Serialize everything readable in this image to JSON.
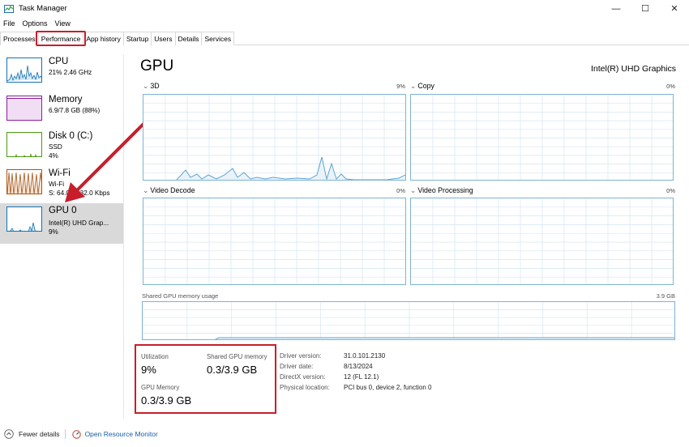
{
  "window": {
    "title": "Task Manager",
    "minimize": "—",
    "maximize": "☐",
    "close": "✕"
  },
  "menu": [
    "File",
    "Options",
    "View"
  ],
  "tabs": [
    "Processes",
    "Performance",
    "App history",
    "Startup",
    "Users",
    "Details",
    "Services"
  ],
  "sidebar": [
    {
      "name": "CPU",
      "line1": "21% 2.46 GHz",
      "line2": "",
      "color": "#1473b3"
    },
    {
      "name": "Memory",
      "line1": "6.9/7.8 GB (88%)",
      "line2": "",
      "color": "#8b1e9b"
    },
    {
      "name": "Disk 0 (C:)",
      "line1": "SSD",
      "line2": "4%",
      "color": "#4d9a11"
    },
    {
      "name": "Wi-Fi",
      "line1": "Wi-Fi",
      "line2": "S: 64.0  R: 32.0 Kbps",
      "color": "#a7561b"
    },
    {
      "name": "GPU 0",
      "line1": "Intel(R) UHD Grap...",
      "line2": "9%",
      "color": "#1473b3"
    }
  ],
  "main": {
    "title": "GPU",
    "device": "Intel(R) UHD Graphics",
    "graphs": [
      {
        "label": "3D",
        "pct": "9%"
      },
      {
        "label": "Copy",
        "pct": "0%"
      },
      {
        "label": "Video Decode",
        "pct": "0%"
      },
      {
        "label": "Video Processing",
        "pct": "0%"
      }
    ],
    "shared_memory_label": "Shared GPU memory usage",
    "shared_memory_max": "3.9 GB"
  },
  "stats": {
    "utilization_label": "Utilization",
    "utilization_value": "9%",
    "shared_label": "Shared GPU memory",
    "shared_value": "0.3/3.9 GB",
    "gpu_memory_label": "GPU Memory",
    "gpu_memory_value": "0.3/3.9 GB"
  },
  "info": [
    {
      "k": "Driver version:",
      "v": "31.0.101.2130"
    },
    {
      "k": "Driver date:",
      "v": "8/13/2024"
    },
    {
      "k": "DirectX version:",
      "v": "12 (FL 12.1)"
    },
    {
      "k": "Physical location:",
      "v": "PCI bus 0, device 2, function 0"
    }
  ],
  "footer": {
    "fewer_details": "Fewer details",
    "resource_monitor": "Open Resource Monitor"
  },
  "colors": {
    "accent": "#1473b3",
    "highlight": "#c81e2b",
    "graph_border": "#7db3d4"
  }
}
